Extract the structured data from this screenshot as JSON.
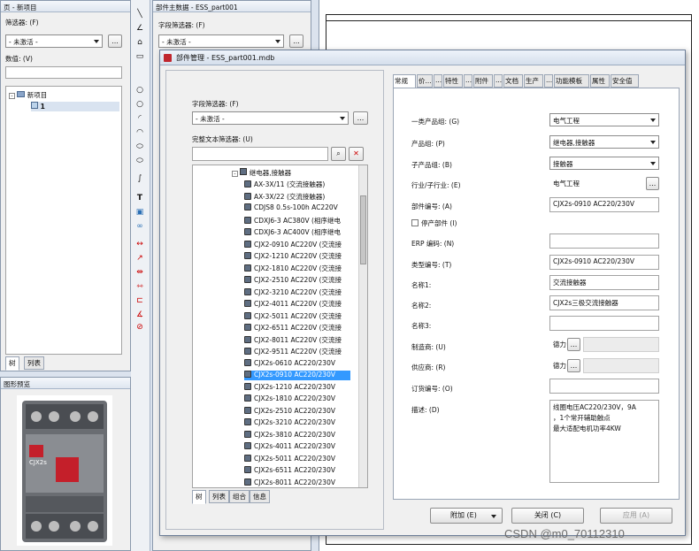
{
  "left_panel": {
    "title": "页 - 新项目",
    "filter_label": "筛选器: (F)",
    "filter_value": "- 未激活 -",
    "filter_btn": "...",
    "value_label": "数值: (V)",
    "tree": [
      {
        "label": "新项目",
        "expanded": true
      },
      {
        "label": "1"
      }
    ],
    "tabs": [
      "树",
      "列表"
    ]
  },
  "preview": {
    "title": "图形预览",
    "product_label": "CJX2s"
  },
  "part_master": {
    "title": "部件主数据 - ESS_part001",
    "filter_label": "字段筛选器: (F)",
    "filter_value": "- 未激活 -",
    "filter_btn": "..."
  },
  "dialog": {
    "title": "部件管理 - ESS_part001.mdb",
    "close": "x",
    "field_filter_label": "字段筛选器: (F)",
    "field_filter_value": "- 未激活 -",
    "field_filter_btn": "...",
    "text_filter_label": "完整文本筛选器: (U)",
    "text_filter_value": "",
    "tree_group": "继电器,接触器",
    "tree_items": [
      "AX-3X/11 (交流接触器)",
      "AX-3X/22 (交流接触器)",
      "CDJS8 0.5s-100h AC220V",
      "CDXJ6-3 AC380V (相序继电",
      "CDXJ6-3 AC400V (相序继电",
      "CJX2-0910 AC220V (交流接",
      "CJX2-1210 AC220V (交流接",
      "CJX2-1810 AC220V (交流接",
      "CJX2-2510 AC220V (交流接",
      "CJX2-3210 AC220V (交流接",
      "CJX2-4011 AC220V (交流接",
      "CJX2-5011 AC220V (交流接",
      "CJX2-6511 AC220V (交流接",
      "CJX2-8011 AC220V (交流接",
      "CJX2-9511 AC220V (交流接",
      "CJX2s-0610 AC220/230V",
      "CJX2s-0910 AC220/230V",
      "CJX2s-1210 AC220/230V",
      "CJX2s-1810 AC220/230V",
      "CJX2s-2510 AC220/230V",
      "CJX2s-3210 AC220/230V",
      "CJX2s-3810 AC220/230V",
      "CJX2s-4011 AC220/230V",
      "CJX2s-5011 AC220/230V",
      "CJX2s-6511 AC220/230V",
      "CJX2s-8011 AC220/230V"
    ],
    "selected_index": 16,
    "left_tabs": [
      "树",
      "列表",
      "组合",
      "信息"
    ],
    "prop_tabs": [
      "常规",
      "价...",
      "...",
      "特性",
      "...",
      "附件",
      "...",
      "文档",
      "生产",
      "...",
      "功能模板",
      "属性",
      "安全值"
    ],
    "fields": {
      "category_label": "一类产品组: (G)",
      "category_value": "电气工程",
      "group_label": "产品组: (P)",
      "group_value": "继电器,接触器",
      "subgroup_label": "子产品组: (B)",
      "subgroup_value": "接触器",
      "industry_label": "行业/子行业: (E)",
      "industry_value": "电气工程",
      "industry_btn": "...",
      "partno_label": "部件编号: (A)",
      "partno_value": "CJX2s-0910 AC220/230V",
      "discontinued_label": "停产部件 (I)",
      "erp_label": "ERP 编码: (N)",
      "erp_value": "",
      "type_label": "类型编号: (T)",
      "type_value": "CJX2s-0910 AC220/230V",
      "name1_label": "名称1:",
      "name1_value": "交流接触器",
      "name2_label": "名称2:",
      "name2_value": "CJX2s三极交流接触器",
      "name3_label": "名称3:",
      "name3_value": "",
      "manufacturer_label": "制造商: (U)",
      "manufacturer_value": "德力",
      "manufacturer_btn": "...",
      "supplier_label": "供应商: (R)",
      "supplier_value": "德力",
      "supplier_btn": "...",
      "order_label": "订货编号: (O)",
      "order_value": "",
      "desc_label": "描述: (D)",
      "desc_lines": [
        "线圈电压AC220/230V，9A",
        "，1个常开辅助触点",
        "最大适配电机功率4KW"
      ]
    },
    "buttons": {
      "extra": "附加 (E)",
      "close": "关闭 (C)",
      "apply": "应用 (A)"
    }
  },
  "watermark": "CSDN @m0_70112310"
}
